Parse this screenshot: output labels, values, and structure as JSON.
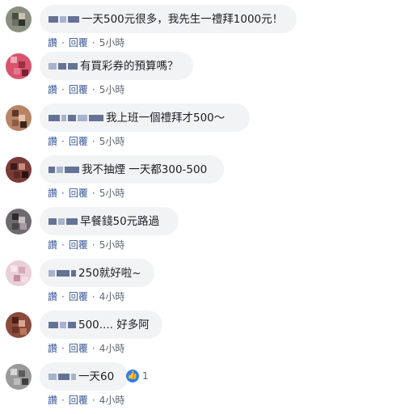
{
  "comments": [
    {
      "text": "一天500元很多，我先生一禮拜1000元！",
      "actions": [
        "讚",
        "回覆"
      ],
      "time": "5小時"
    },
    {
      "text": "有買彩券的預算嗎？",
      "actions": [
        "讚",
        "回覆"
      ],
      "time": "5小時"
    },
    {
      "text": "我上班一個禮拜才500～",
      "actions": [
        "讚",
        "回覆"
      ],
      "time": "5小時"
    },
    {
      "text": "我不抽煙 一天都300-500",
      "actions": [
        "讚",
        "回覆"
      ],
      "time": "5小時"
    },
    {
      "text": "早餐錢50元路過",
      "actions": [
        "讚",
        "回覆"
      ],
      "time": "5小時"
    },
    {
      "text": "250就好啦~",
      "actions": [
        "讚",
        "回覆"
      ],
      "time": "4小時"
    },
    {
      "text": "500.... 好多阿",
      "actions": [
        "讚",
        "回覆"
      ],
      "time": "4小時"
    },
    {
      "text": "一天60",
      "actions": [
        "讚",
        "回覆"
      ],
      "time": "4小時",
      "reaction": {
        "icon": "like-icon",
        "count": "1"
      }
    }
  ],
  "colors": {
    "bubble": "#f2f3f5",
    "link": "#385898",
    "meta": "#606770",
    "like": "#2f7df6"
  }
}
